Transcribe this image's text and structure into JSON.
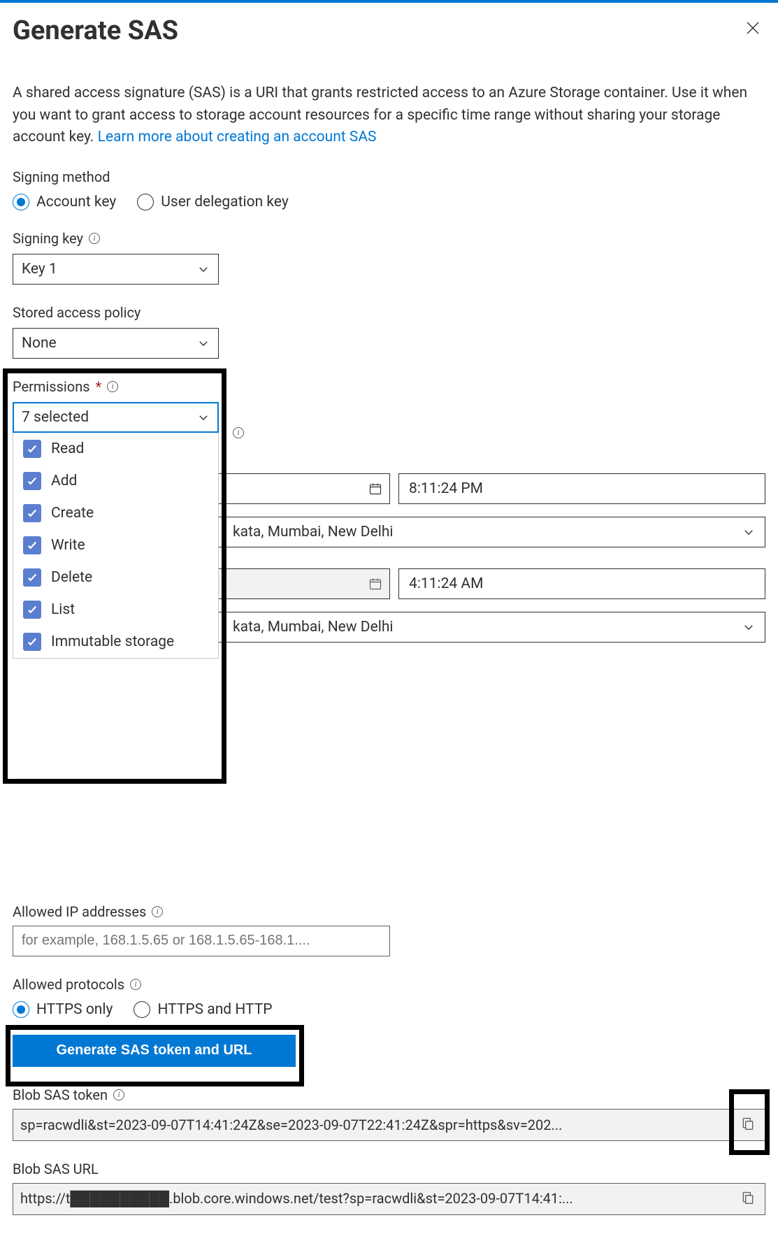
{
  "header": {
    "title": "Generate SAS"
  },
  "description": {
    "text": "A shared access signature (SAS) is a URI that grants restricted access to an Azure Storage container. Use it when you want to grant access to storage account resources for a specific time range without sharing your storage account key. ",
    "link": "Learn more about creating an account SAS"
  },
  "signing_method": {
    "label": "Signing method",
    "options": {
      "account_key": "Account key",
      "user_delegation": "User delegation key"
    }
  },
  "signing_key": {
    "label": "Signing key",
    "selected": "Key 1"
  },
  "stored_policy": {
    "label": "Stored access policy",
    "selected": "None"
  },
  "permissions": {
    "label": "Permissions",
    "selected_summary": "7 selected",
    "options": {
      "read": "Read",
      "add": "Add",
      "create": "Create",
      "write": "Write",
      "delete": "Delete",
      "list": "List",
      "immutable": "Immutable storage"
    }
  },
  "start": {
    "time": "8:11:24 PM",
    "tz_visible": "kata, Mumbai, New Delhi"
  },
  "expiry": {
    "time": "4:11:24 AM",
    "tz_visible": "kata, Mumbai, New Delhi"
  },
  "allowed_ip": {
    "label": "Allowed IP addresses",
    "placeholder": "for example, 168.1.5.65 or 168.1.5.65-168.1...."
  },
  "protocols": {
    "label": "Allowed protocols",
    "options": {
      "https_only": "HTTPS only",
      "https_http": "HTTPS and HTTP"
    }
  },
  "generate_button": "Generate SAS token and URL",
  "sas_token": {
    "label": "Blob SAS token",
    "value": "sp=racwdli&st=2023-09-07T14:41:24Z&se=2023-09-07T22:41:24Z&spr=https&sv=202..."
  },
  "sas_url": {
    "label": "Blob SAS URL",
    "value": "https://t██████████.blob.core.windows.net/test?sp=racwdli&st=2023-09-07T14:41:..."
  }
}
